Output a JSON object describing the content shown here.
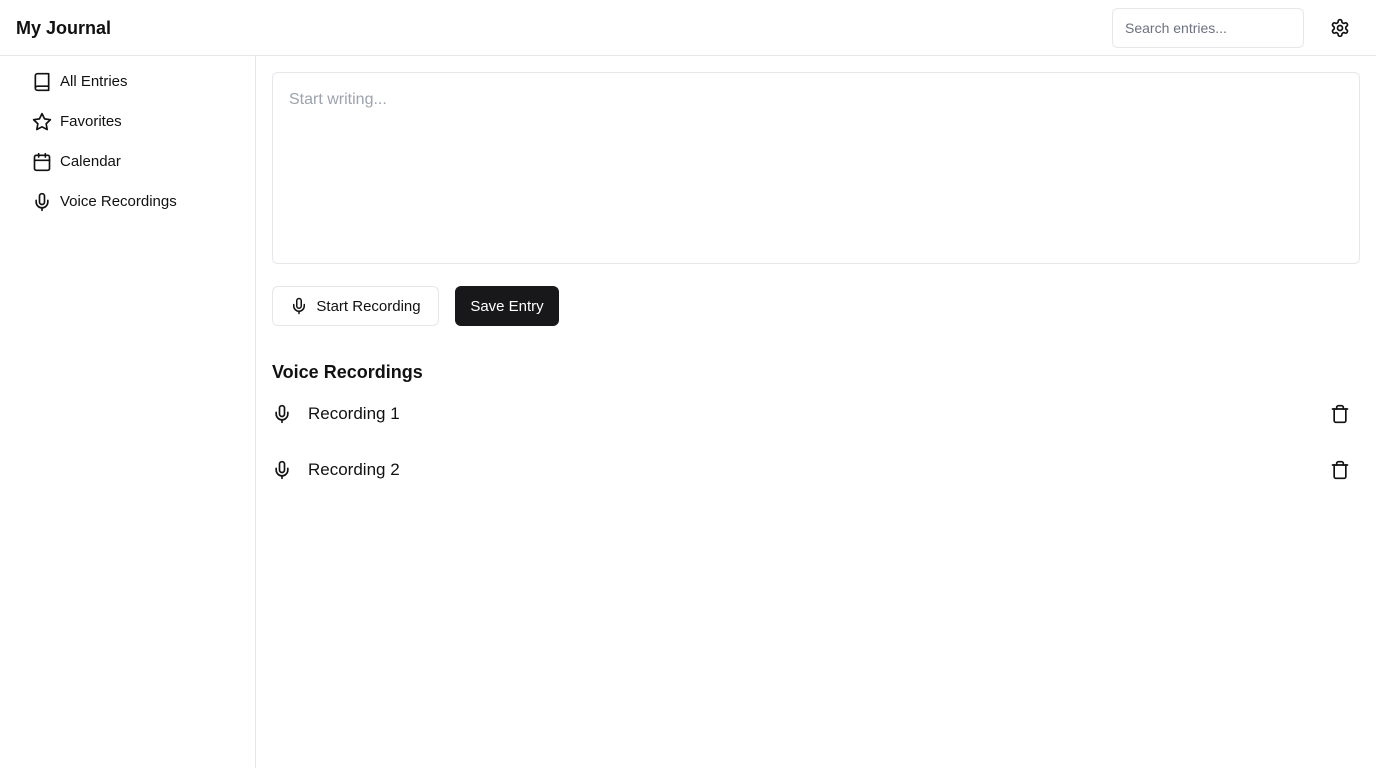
{
  "header": {
    "title": "My Journal",
    "search_placeholder": "Search entries...",
    "settings_icon": "gear-icon"
  },
  "sidebar": {
    "items": [
      {
        "label": "All Entries",
        "icon": "book-icon"
      },
      {
        "label": "Favorites",
        "icon": "star-icon"
      },
      {
        "label": "Calendar",
        "icon": "calendar-icon"
      },
      {
        "label": "Voice Recordings",
        "icon": "microphone-icon"
      }
    ]
  },
  "editor": {
    "placeholder": "Start writing...",
    "value": ""
  },
  "actions": {
    "record_label": "Start Recording",
    "record_icon": "microphone-icon",
    "save_label": "Save Entry"
  },
  "recordings": {
    "title": "Voice Recordings",
    "items": [
      {
        "label": "Recording 1",
        "icon": "microphone-icon",
        "action_icon": "trash-icon"
      },
      {
        "label": "Recording 2",
        "icon": "microphone-icon",
        "action_icon": "trash-icon"
      }
    ]
  },
  "colors": {
    "primary_button": "#18181b",
    "border": "#e5e7eb",
    "placeholder": "#9ca3af"
  }
}
